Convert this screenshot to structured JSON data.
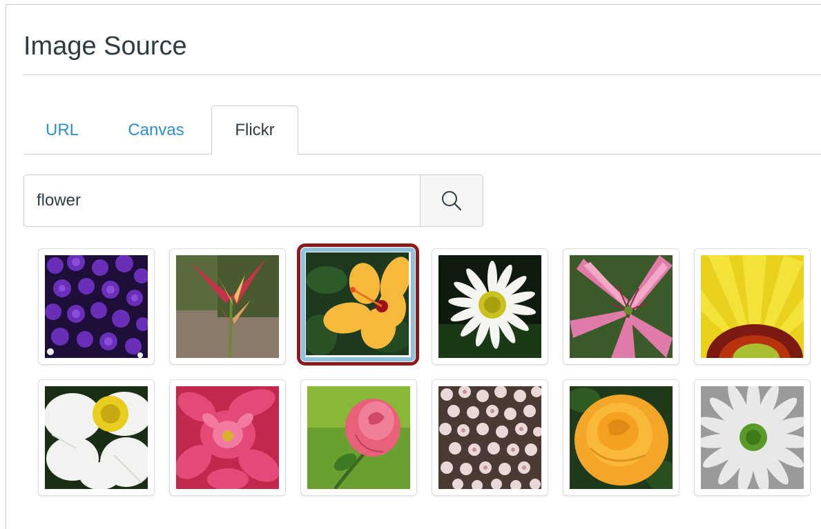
{
  "dialog": {
    "title": "Image Source"
  },
  "tabs": [
    {
      "label": "URL",
      "active": false
    },
    {
      "label": "Canvas",
      "active": false
    },
    {
      "label": "Flickr",
      "active": true
    }
  ],
  "search": {
    "value": "flower",
    "button_icon": "search-icon"
  },
  "results": {
    "selected_index": 2,
    "items": [
      {
        "icon": "purple-violets-thumbnail"
      },
      {
        "icon": "heliconia-thumbnail"
      },
      {
        "icon": "orange-hibiscus-thumbnail"
      },
      {
        "icon": "white-daisy-thumbnail"
      },
      {
        "icon": "pink-lily-thumbnail"
      },
      {
        "icon": "yellow-gazania-thumbnail"
      },
      {
        "icon": "white-poppy-thumbnail"
      },
      {
        "icon": "pink-dahlia-thumbnail"
      },
      {
        "icon": "pink-rose-thumbnail"
      },
      {
        "icon": "pale-blossom-cluster-thumbnail"
      },
      {
        "icon": "orange-rose-thumbnail"
      },
      {
        "icon": "white-daisy-closeup-thumbnail"
      }
    ]
  },
  "colors": {
    "link": "#2b8ed6",
    "text": "#2d3b45",
    "border": "#c7cdd1",
    "selected_outer": "#8b1a1a",
    "selected_inner": "#8ec3df"
  }
}
